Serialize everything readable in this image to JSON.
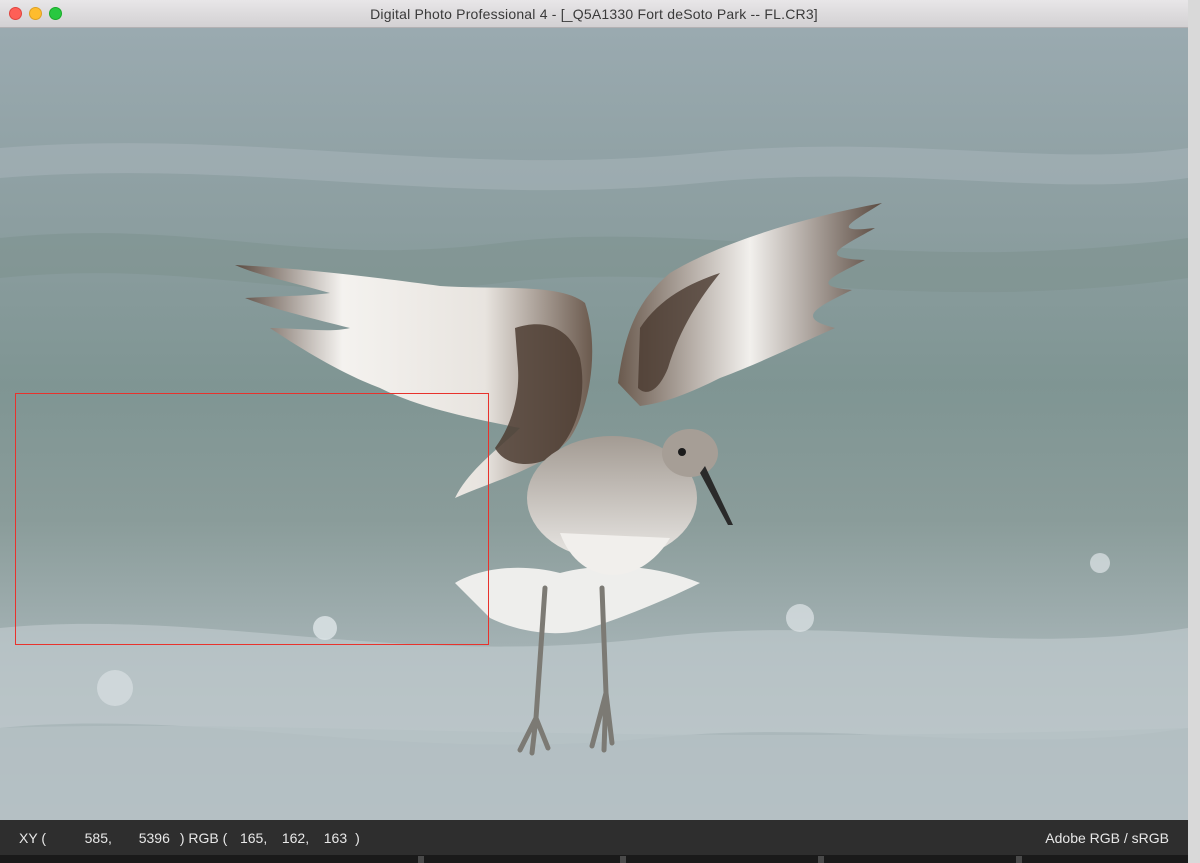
{
  "window": {
    "title": "Digital Photo Professional 4 - [_Q5A1330 Fort deSoto Park -- FL.CR3]"
  },
  "status": {
    "xy_label": "XY (",
    "x": "585",
    "y": "5396",
    "rgb_label": ") RGB (",
    "r": "165",
    "g": "162",
    "b": "163",
    "close_paren": ")",
    "color_space": "Adobe RGB / sRGB"
  },
  "image": {
    "subject": "bird"
  },
  "colors": {
    "selection": "#e8322c",
    "statusbar": "#2e2e2e"
  }
}
